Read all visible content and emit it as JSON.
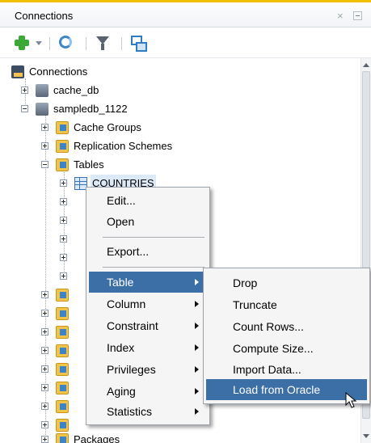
{
  "panel": {
    "title": "Connections",
    "close_glyph": "×"
  },
  "toolbar": {
    "icons": [
      "add-connection-icon",
      "dropdown-arrow-icon",
      "refresh-icon",
      "filter-icon",
      "schema-browser-icon"
    ]
  },
  "tree": {
    "root": "Connections",
    "items": [
      {
        "label": "cache_db"
      },
      {
        "label": "sampledb_1122"
      },
      {
        "label": "Cache Groups"
      },
      {
        "label": "Replication Schemes"
      },
      {
        "label": "Tables"
      },
      {
        "label": "COUNTRIES"
      },
      {
        "label": "Packages"
      }
    ]
  },
  "context_menu": {
    "items": [
      {
        "label": "Edit..."
      },
      {
        "label": "Open"
      },
      {
        "label": "Export..."
      },
      {
        "label": "Table"
      },
      {
        "label": "Column"
      },
      {
        "label": "Constraint"
      },
      {
        "label": "Index"
      },
      {
        "label": "Privileges"
      },
      {
        "label": "Aging"
      },
      {
        "label": "Statistics"
      }
    ]
  },
  "submenu": {
    "items": [
      {
        "label": "Drop"
      },
      {
        "label": "Truncate"
      },
      {
        "label": "Count Rows..."
      },
      {
        "label": "Compute Size..."
      },
      {
        "label": "Import Data..."
      },
      {
        "label": "Load from Oracle"
      }
    ]
  },
  "colors": {
    "accent": "#3d6fa7",
    "title_border": "#f0c000"
  }
}
